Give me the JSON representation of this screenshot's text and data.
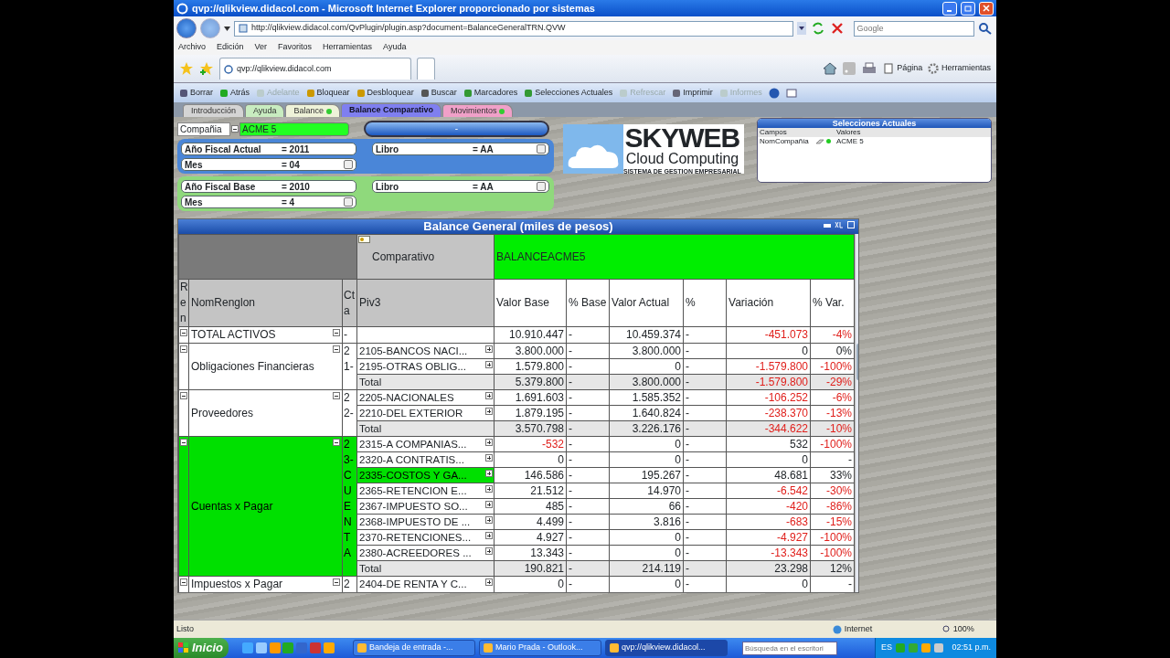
{
  "window": {
    "title": "qvp://qlikview.didacol.com - Microsoft Internet Explorer proporcionado por sistemas"
  },
  "address_bar": {
    "url": "http://qlikview.didacol.com/QvPlugin/plugin.asp?document=BalanceGeneralTRN.QVW",
    "search_placeholder": "Google"
  },
  "menu": [
    "Archivo",
    "Edición",
    "Ver",
    "Favoritos",
    "Herramientas",
    "Ayuda"
  ],
  "browser_tab": {
    "label": "qvp://qlikview.didacol.com"
  },
  "command_bar": [
    "Página",
    "Herramientas"
  ],
  "toolbar": [
    {
      "label": "Borrar",
      "disabled": false
    },
    {
      "label": "Atrás",
      "disabled": false
    },
    {
      "label": "Adelante",
      "disabled": true
    },
    {
      "label": "Bloquear",
      "disabled": false
    },
    {
      "label": "Desbloquear",
      "disabled": false
    },
    {
      "label": "Buscar",
      "disabled": false
    },
    {
      "label": "Marcadores",
      "disabled": false
    },
    {
      "label": "Selecciones Actuales",
      "disabled": false
    },
    {
      "label": "Refrescar",
      "disabled": true
    },
    {
      "label": "Imprimir",
      "disabled": false
    },
    {
      "label": "Informes",
      "disabled": true
    }
  ],
  "sheet_tabs": [
    {
      "label": "Introducción",
      "selected": false,
      "color": "#d4d4d4",
      "indicator": false
    },
    {
      "label": "Ayuda",
      "selected": false,
      "color": "#c8ecc0",
      "indicator": false
    },
    {
      "label": "Balance",
      "selected": false,
      "color": "#eef2d8",
      "indicator": true
    },
    {
      "label": "Balance Comparativo",
      "selected": true,
      "color": "#7f7ff0",
      "indicator": false
    },
    {
      "label": "Movimientos",
      "selected": false,
      "color": "#f0a0c8",
      "indicator": true
    }
  ],
  "company": {
    "label": "Compañia",
    "value": "ACME 5",
    "button": "-"
  },
  "filter_groups": [
    {
      "color": "#4a86d8",
      "filters": [
        {
          "label": "Año Fiscal Actual",
          "value": "= 2011",
          "has_menu": false
        },
        {
          "label": "Libro",
          "value": "= AA",
          "has_menu": true
        },
        {
          "label": "Mes",
          "value": "= 04",
          "has_menu": true
        }
      ]
    },
    {
      "color": "#8fd97c",
      "filters": [
        {
          "label": "Año Fiscal Base",
          "value": "= 2010",
          "has_menu": false
        },
        {
          "label": "Libro",
          "value": "= AA",
          "has_menu": true
        },
        {
          "label": "Mes",
          "value": "= 4",
          "has_menu": true
        }
      ]
    }
  ],
  "logo": {
    "name": "SKYWEB",
    "subtitle": "Cloud Computing",
    "tagline": "SISTEMA DE GESTION EMPRESARIAL"
  },
  "selections": {
    "title": "Selecciones Actuales",
    "columns": [
      "Campos",
      "Valores"
    ],
    "rows": [
      {
        "field": "NomCompañía",
        "value": "ACME 5"
      }
    ]
  },
  "table": {
    "title": "Balance General (miles de pesos)",
    "pivot_label": "Comparativo",
    "pivot_value": "BALANCEACME5",
    "columns": [
      "Ren",
      "NomRenglon",
      "Cta",
      "Piv3",
      "Valor Base",
      "% Base",
      "Valor Actual",
      "%",
      "Variación",
      "% Var."
    ],
    "groups": [
      {
        "name": "TOTAL ACTIVOS",
        "cta": "-",
        "highlighted": false,
        "rows": [
          {
            "kind": "summary",
            "valor_base": "10.910.447",
            "pct_base": "-",
            "valor_actual": "10.459.374",
            "pct": "-",
            "variacion": "-451.073",
            "pct_var": "-4%",
            "base_red": false,
            "var_red": true,
            "pvar_red": true
          }
        ]
      },
      {
        "name": "Obligaciones Financieras",
        "cta": "21-",
        "highlighted": false,
        "rows": [
          {
            "kind": "detail",
            "piv3": "2105-BANCOS NACI...",
            "valor_base": "3.800.000",
            "pct_base": "-",
            "valor_actual": "3.800.000",
            "pct": "-",
            "variacion": "0",
            "pct_var": "0%",
            "base_red": false,
            "var_red": false,
            "pvar_red": false,
            "selected": false
          },
          {
            "kind": "detail",
            "piv3": "2195-OTRAS OBLIG...",
            "valor_base": "1.579.800",
            "pct_base": "-",
            "valor_actual": "0",
            "pct": "-",
            "variacion": "-1.579.800",
            "pct_var": "-100%",
            "base_red": false,
            "var_red": true,
            "pvar_red": true,
            "selected": false
          },
          {
            "kind": "total",
            "piv3": "Total",
            "valor_base": "5.379.800",
            "pct_base": "-",
            "valor_actual": "3.800.000",
            "pct": "-",
            "variacion": "-1.579.800",
            "pct_var": "-29%",
            "base_red": false,
            "var_red": true,
            "pvar_red": true,
            "selected": false
          }
        ]
      },
      {
        "name": "Proveedores",
        "cta": "22-",
        "highlighted": false,
        "rows": [
          {
            "kind": "detail",
            "piv3": "2205-NACIONALES",
            "valor_base": "1.691.603",
            "pct_base": "-",
            "valor_actual": "1.585.352",
            "pct": "-",
            "variacion": "-106.252",
            "pct_var": "-6%",
            "base_red": false,
            "var_red": true,
            "pvar_red": true,
            "selected": false
          },
          {
            "kind": "detail",
            "piv3": "2210-DEL EXTERIOR",
            "valor_base": "1.879.195",
            "pct_base": "-",
            "valor_actual": "1.640.824",
            "pct": "-",
            "variacion": "-238.370",
            "pct_var": "-13%",
            "base_red": false,
            "var_red": true,
            "pvar_red": true,
            "selected": false
          },
          {
            "kind": "total",
            "piv3": "Total",
            "valor_base": "3.570.798",
            "pct_base": "-",
            "valor_actual": "3.226.176",
            "pct": "-",
            "variacion": "-344.622",
            "pct_var": "-10%",
            "base_red": false,
            "var_red": true,
            "pvar_red": true,
            "selected": false
          }
        ]
      },
      {
        "name": "Cuentas x Pagar",
        "cta": "23-CUENTA",
        "highlighted": true,
        "rows": [
          {
            "kind": "detail",
            "piv3": "2315-A COMPANIAS...",
            "valor_base": "-532",
            "pct_base": "-",
            "valor_actual": "0",
            "pct": "-",
            "variacion": "532",
            "pct_var": "-100%",
            "base_red": true,
            "var_red": false,
            "pvar_red": true,
            "selected": false
          },
          {
            "kind": "detail",
            "piv3": "2320-A CONTRATIS...",
            "valor_base": "0",
            "pct_base": "-",
            "valor_actual": "0",
            "pct": "-",
            "variacion": "0",
            "pct_var": "-",
            "base_red": false,
            "var_red": false,
            "pvar_red": false,
            "selected": false
          },
          {
            "kind": "detail",
            "piv3": "2335-COSTOS Y GA...",
            "valor_base": "146.586",
            "pct_base": "-",
            "valor_actual": "195.267",
            "pct": "-",
            "variacion": "48.681",
            "pct_var": "33%",
            "base_red": false,
            "var_red": false,
            "pvar_red": false,
            "selected": true
          },
          {
            "kind": "detail",
            "piv3": "2365-RETENCION E...",
            "valor_base": "21.512",
            "pct_base": "-",
            "valor_actual": "14.970",
            "pct": "-",
            "variacion": "-6.542",
            "pct_var": "-30%",
            "base_red": false,
            "var_red": true,
            "pvar_red": true,
            "selected": false
          },
          {
            "kind": "detail",
            "piv3": "2367-IMPUESTO SO...",
            "valor_base": "485",
            "pct_base": "-",
            "valor_actual": "66",
            "pct": "-",
            "variacion": "-420",
            "pct_var": "-86%",
            "base_red": false,
            "var_red": true,
            "pvar_red": true,
            "selected": false
          },
          {
            "kind": "detail",
            "piv3": "2368-IMPUESTO DE ...",
            "valor_base": "4.499",
            "pct_base": "-",
            "valor_actual": "3.816",
            "pct": "-",
            "variacion": "-683",
            "pct_var": "-15%",
            "base_red": false,
            "var_red": true,
            "pvar_red": true,
            "selected": false
          },
          {
            "kind": "detail",
            "piv3": "2370-RETENCIONES...",
            "valor_base": "4.927",
            "pct_base": "-",
            "valor_actual": "0",
            "pct": "-",
            "variacion": "-4.927",
            "pct_var": "-100%",
            "base_red": false,
            "var_red": true,
            "pvar_red": true,
            "selected": false
          },
          {
            "kind": "detail",
            "piv3": "2380-ACREEDORES ...",
            "valor_base": "13.343",
            "pct_base": "-",
            "valor_actual": "0",
            "pct": "-",
            "variacion": "-13.343",
            "pct_var": "-100%",
            "base_red": false,
            "var_red": true,
            "pvar_red": true,
            "selected": false
          },
          {
            "kind": "total",
            "piv3": "Total",
            "valor_base": "190.821",
            "pct_base": "-",
            "valor_actual": "214.119",
            "pct": "-",
            "variacion": "23.298",
            "pct_var": "12%",
            "base_red": false,
            "var_red": false,
            "pvar_red": false,
            "selected": false
          }
        ]
      },
      {
        "name": "Impuestos x Pagar",
        "cta": "2",
        "highlighted": false,
        "rows": [
          {
            "kind": "detail",
            "piv3": "2404-DE RENTA Y C...",
            "valor_base": "0",
            "pct_base": "-",
            "valor_actual": "0",
            "pct": "-",
            "variacion": "0",
            "pct_var": "-",
            "base_red": false,
            "var_red": false,
            "pvar_red": false,
            "selected": false
          }
        ]
      }
    ]
  },
  "status_bar": {
    "text": "Listo",
    "zone": "Internet",
    "zoom": "100%"
  },
  "taskbar": {
    "start": "Inicio",
    "tasks": [
      {
        "label": "Bandeja de entrada -...",
        "selected": false
      },
      {
        "label": "Mario Prada - Outlook...",
        "selected": false
      },
      {
        "label": "qvp://qlikview.didacol...",
        "selected": true
      }
    ],
    "search_placeholder": "Búsqueda en el escritori",
    "language": "ES",
    "clock": "02:51 p.m."
  }
}
